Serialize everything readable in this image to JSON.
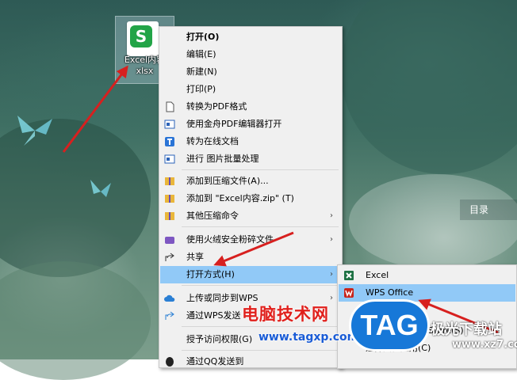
{
  "desktop": {
    "file_icon": {
      "label_line1": "Excel内容",
      "label_line2": "xlsx",
      "badge": "S"
    },
    "side_label": "目录"
  },
  "context_menu": {
    "items": [
      {
        "label": "打开(O)",
        "bold": true
      },
      {
        "label": "编辑(E)"
      },
      {
        "label": "新建(N)"
      },
      {
        "label": "打印(P)"
      },
      {
        "label": "转换为PDF格式"
      },
      {
        "label": "使用金舟PDF编辑器打开"
      },
      {
        "label": "转为在线文档"
      },
      {
        "label": "进行 图片批量处理"
      },
      {
        "label": "添加到压缩文件(A)..."
      },
      {
        "label": "添加到 \"Excel内容.zip\" (T)"
      },
      {
        "label": "其他压缩命令"
      },
      {
        "label": "使用火绒安全粉碎文件"
      },
      {
        "label": "共享"
      },
      {
        "label": "打开方式(H)"
      },
      {
        "label": "上传或同步到WPS"
      },
      {
        "label": "通过WPS发送"
      },
      {
        "label": "授予访问权限(G)"
      },
      {
        "label": "通过QQ发送到"
      }
    ],
    "submenu_arrow": "›"
  },
  "open_with_submenu": {
    "items": [
      {
        "label": "Excel"
      },
      {
        "label": "WPS Office"
      },
      {
        "label": "搜索 Microsoft Store(S)"
      },
      {
        "label": "选择其他应用(C)"
      }
    ]
  },
  "watermark": {
    "site_name": "电脑技术网",
    "url": "www.tagxp.com",
    "tag": "TAG",
    "brand": "极光下载站",
    "brand_url": "www.xz7.com"
  },
  "colors": {
    "menu_bg": "#f0f0f0",
    "highlight": "#91c9f7",
    "arrow_red": "#d7201f",
    "excel_green": "#1f7244",
    "wps_red": "#c8241b",
    "tag_blue": "#1778d8"
  }
}
